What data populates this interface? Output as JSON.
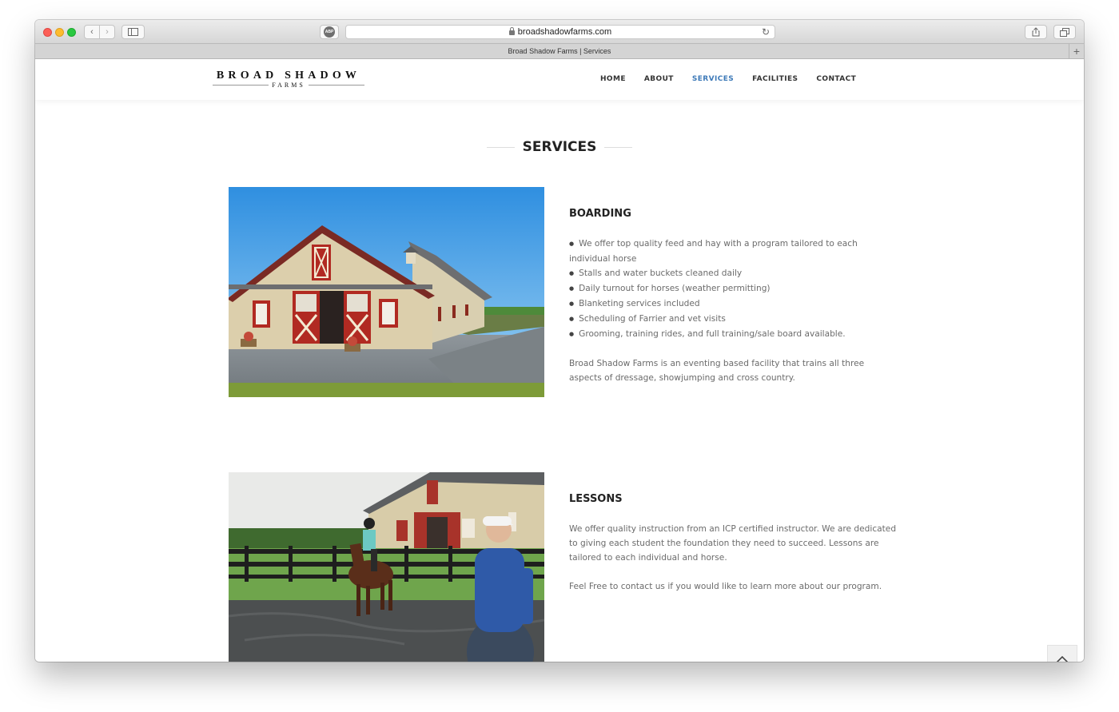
{
  "browser": {
    "url": "broadshadowfarms.com",
    "tab_title": "Broad Shadow Farms | Services",
    "abp_label": "ABP"
  },
  "site": {
    "logo_top": "BROAD SHADOW",
    "logo_bottom": "FARMS",
    "nav": [
      "HOME",
      "ABOUT",
      "SERVICES",
      "FACILITIES",
      "CONTACT"
    ],
    "active_nav": "SERVICES",
    "accent_color": "#3e7ab8"
  },
  "main": {
    "section_title": "SERVICES",
    "boarding": {
      "title": "BOARDING",
      "bullets": [
        "We offer top quality feed and hay with a program tailored to each individual horse",
        "Stalls and water buckets cleaned daily",
        "Daily turnout for horses (weather permitting)",
        "Blanketing services included",
        "Scheduling of Farrier and vet visits",
        "Grooming, training rides, and full training/sale board available."
      ],
      "paragraph": "Broad Shadow Farms is an eventing based facility that trains all three aspects of dressage, showjumping and cross country."
    },
    "lessons": {
      "title": "LESSONS",
      "paragraph1": "We offer quality instruction from an ICP certified instructor. We are dedicated to giving each student the foundation they need to succeed. Lessons are tailored to each individual and horse.",
      "paragraph2": "Feel Free to contact us if you would like to learn more about our program."
    }
  }
}
